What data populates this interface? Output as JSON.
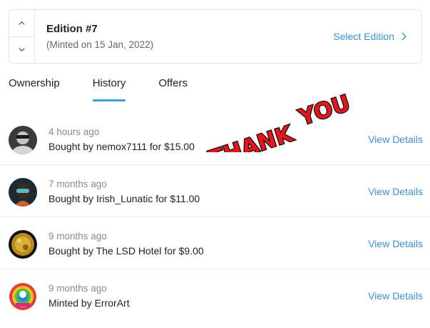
{
  "edition": {
    "title": "Edition #7",
    "subtitle": "(Minted on 15 Jan, 2022)",
    "select_label": "Select Edition"
  },
  "tabs": [
    {
      "label": "Ownership",
      "active": false
    },
    {
      "label": "History",
      "active": true
    },
    {
      "label": "Offers",
      "active": false
    }
  ],
  "history": [
    {
      "when": "4 hours ago",
      "what": "Bought by nemox7111 for $15.00",
      "action": "View Details"
    },
    {
      "when": "7 months ago",
      "what": "Bought by Irish_Lunatic for $11.00",
      "action": "View Details"
    },
    {
      "when": "9 months ago",
      "what": "Bought by The LSD Hotel for $9.00",
      "action": "View Details"
    },
    {
      "when": "9 months ago",
      "what": "Minted by ErrorArt",
      "action": "View Details"
    }
  ],
  "overlay": {
    "word1": "THANK",
    "word2": "YOU",
    "color": "#e8141c"
  },
  "colors": {
    "accent": "#3a8fd0",
    "tab_underline": "#3a9ee0"
  }
}
